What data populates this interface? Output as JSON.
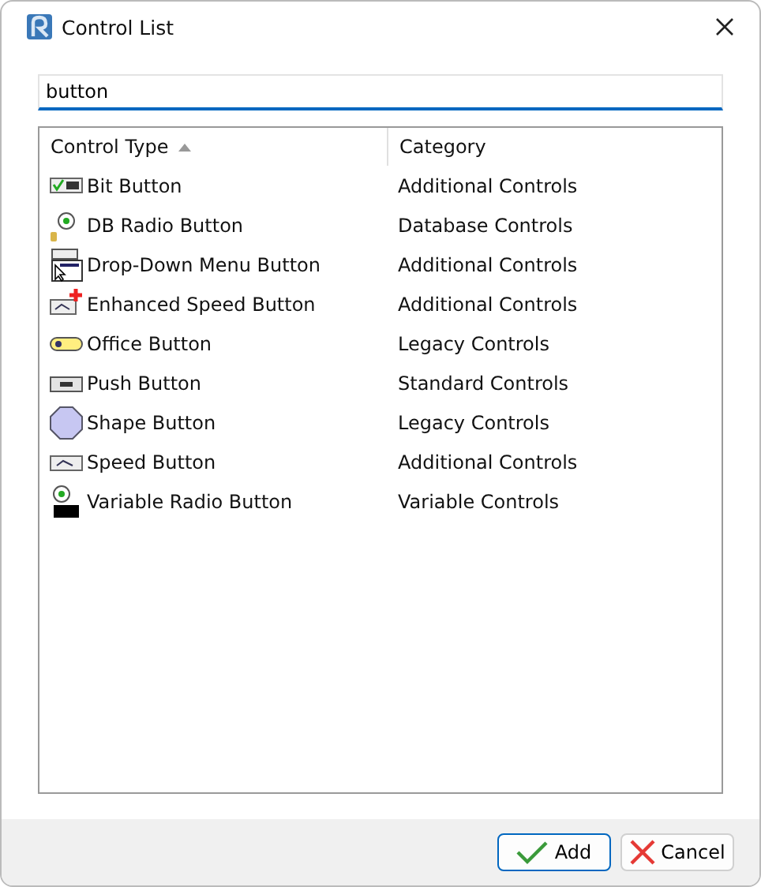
{
  "window": {
    "title": "Control List"
  },
  "search": {
    "value": "button"
  },
  "table": {
    "columns": [
      {
        "label": "Control Type",
        "sorted": true
      },
      {
        "label": "Category",
        "sorted": false
      }
    ],
    "rows": [
      {
        "kind": "bit",
        "name": "Bit Button",
        "category": "Additional Controls"
      },
      {
        "kind": "dbradio",
        "name": "DB Radio Button",
        "category": "Database Controls"
      },
      {
        "kind": "dropdown",
        "name": "Drop-Down Menu Button",
        "category": "Additional Controls"
      },
      {
        "kind": "enhanced",
        "name": "Enhanced Speed Button",
        "category": "Additional Controls"
      },
      {
        "kind": "office",
        "name": "Office Button",
        "category": "Legacy Controls"
      },
      {
        "kind": "push",
        "name": "Push Button",
        "category": "Standard Controls"
      },
      {
        "kind": "shape",
        "name": "Shape Button",
        "category": "Legacy Controls"
      },
      {
        "kind": "speed",
        "name": "Speed Button",
        "category": "Additional Controls"
      },
      {
        "kind": "varradio",
        "name": "Variable Radio Button",
        "category": "Variable Controls"
      }
    ]
  },
  "buttons": [
    {
      "kind": "ok",
      "label": "Add",
      "default": true
    },
    {
      "kind": "cancel",
      "label": "Cancel",
      "default": false
    }
  ]
}
